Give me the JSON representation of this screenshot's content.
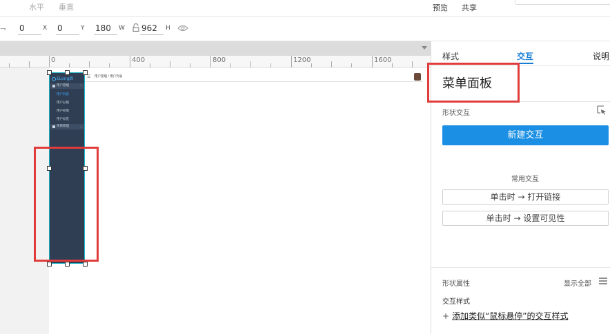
{
  "toolbar": {
    "align_horizontal": "水平",
    "align_vertical": "垂直",
    "preview": "预览",
    "share": "共享"
  },
  "properties": {
    "x_value": "0",
    "x_label": "X",
    "y_value": "0",
    "y_label": "Y",
    "w_value": "180",
    "w_label": "W",
    "h_value": "962",
    "h_label": "H"
  },
  "ruler": {
    "labels": [
      "0",
      "400",
      "800",
      "1200",
      "1600"
    ]
  },
  "prototype": {
    "logo_text": "ELong后",
    "breadcrumb": "用户管理 / 用户列表",
    "menu_groups": [
      "用户管理",
      "项目管理"
    ],
    "menu_items": [
      "用户列表",
      "用户分组",
      "用户权限",
      "用户标签"
    ]
  },
  "inspector": {
    "tabs": [
      "样式",
      "交互",
      "说明"
    ],
    "active_tab": "交互",
    "widget_name": "菜单面板",
    "shape_interaction_label": "形状交互",
    "new_interaction_button": "新建交互",
    "common_interactions_label": "常用交互",
    "common_interactions": [
      "单击时 → 打开链接",
      "单击时 → 设置可见性"
    ],
    "shape_properties_label": "形状属性",
    "show_all": "显示全部",
    "interaction_style_label": "交互样式",
    "add_style_plus": "+",
    "add_style_link": "添加类似“鼠标悬停”的交互样式"
  },
  "colors": {
    "accent": "#1a8fe3",
    "menu_panel_bg": "#2f3e52",
    "highlight": "#e03c3c"
  },
  "icons": [
    "edge-icon",
    "lock-icon",
    "eye-icon",
    "pick-icon",
    "menu-lines-icon",
    "hamburger-icon",
    "collapse-arrow-icon"
  ]
}
